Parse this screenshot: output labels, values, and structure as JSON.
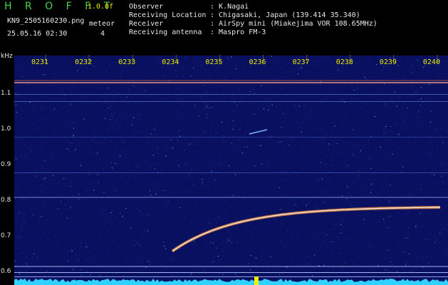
{
  "header": {
    "brand": "H R O F F T",
    "version": "1.0.0f",
    "filename": "KN9_2505160230.png",
    "datetime": "25.05.16 02:30",
    "meteor_label": "meteor",
    "meteor_count": "4",
    "info": [
      {
        "label": "Observer",
        "value": ": K.Nagai"
      },
      {
        "label": "Receiving Location",
        "value": ": Chigasaki, Japan (139.414 35.340)"
      },
      {
        "label": "Receiver",
        "value": ": AirSpy mini (Miakejima VOR 108.65MHz)"
      },
      {
        "label": "Receiving antenna",
        "value": ": Maspro FM-3"
      }
    ]
  },
  "spectrogram": {
    "y_unit": "kHz",
    "y_ticks": [
      1.1,
      1.0,
      0.9,
      0.8,
      0.7,
      0.6
    ],
    "time_ticks": [
      "0231",
      "0232",
      "0233",
      "0234",
      "0235",
      "0236",
      "0237",
      "0238",
      "0239",
      "0240"
    ],
    "colors": {
      "background": "#0a1060",
      "noise_dim": "#2030b0",
      "noise_bright": "#7fd0ff",
      "trace": "#ff9a3a",
      "trace_core": "#ffffff",
      "baseline": "#30d0ff",
      "marker": "#f0f000"
    }
  }
}
